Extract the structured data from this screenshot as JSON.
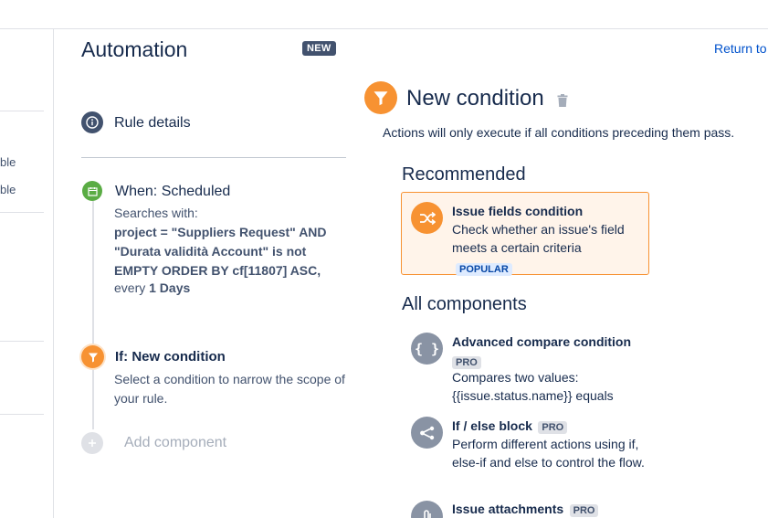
{
  "header": {
    "title": "Automation",
    "badge": "NEW",
    "return_link": "Return to"
  },
  "leftnav": {
    "fragments": [
      "ble",
      "ble"
    ]
  },
  "rule": {
    "details_label": "Rule details",
    "trigger": {
      "label": "When: Scheduled",
      "searches_label": "Searches with:",
      "jql": "project = \"Suppliers Request\" AND \"Durata validità Account\" is not EMPTY ORDER BY cf[11807] ASC,",
      "every_prefix": "every",
      "every_value": "1 Days"
    },
    "condition": {
      "label": "If: New condition",
      "description": "Select a condition to narrow the scope of your rule."
    },
    "add_component": "Add component"
  },
  "panel": {
    "title": "New condition",
    "description": "Actions will only execute if all conditions preceding them pass.",
    "recommended_heading": "Recommended",
    "recommended": {
      "name": "Issue fields condition",
      "description": "Check whether an issue's field meets a certain criteria",
      "tag": "POPULAR",
      "icon": "shuffle-icon"
    },
    "all_heading": "All components",
    "components": [
      {
        "name": "Advanced compare condition",
        "tag": "PRO",
        "description": "Compares two values: {{issue.status.name}} equals",
        "icon": "braces-icon"
      },
      {
        "name": "If / else block",
        "tag": "PRO",
        "description": "Perform different actions using if, else-if and else to control the flow.",
        "icon": "branch-icon"
      },
      {
        "name": "Issue attachments",
        "tag": "PRO",
        "description": "",
        "icon": "paperclip-icon"
      }
    ]
  },
  "colors": {
    "accent_orange": "#f79232",
    "trigger_green": "#5aac44",
    "info_blue": "#42526e",
    "link": "#0052cc"
  }
}
